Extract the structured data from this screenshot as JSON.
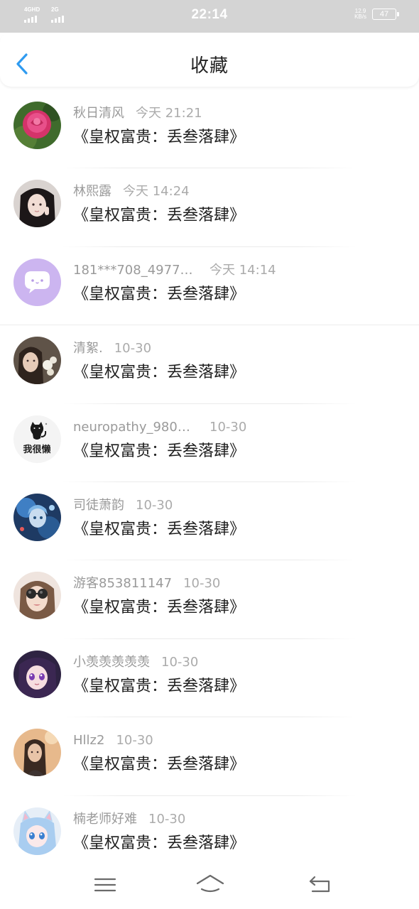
{
  "status_bar": {
    "signal_1_label": "4GHD",
    "signal_2_label": "2G",
    "time": "22:14",
    "net_speed_value": "12.9",
    "net_speed_unit": "KB/s",
    "battery": "47"
  },
  "header": {
    "title": "收藏",
    "back_icon": "chevron-left-icon",
    "back_color": "#2f9bf0"
  },
  "favorites": [
    {
      "user": "秋日清风",
      "time": "今天 21:21",
      "title": "《皇权富贵：丢叁落肆》",
      "avatar": "rose"
    },
    {
      "user": "林熙露",
      "time": "今天 14:24",
      "title": "《皇权富贵：丢叁落肆》",
      "avatar": "dark-hair-girl"
    },
    {
      "user": "181***708_4977…",
      "time": "今天 14:14",
      "title": "《皇权富贵：丢叁落肆》",
      "avatar": "chat-bubble"
    },
    {
      "user": "清絮.",
      "time": "10-30",
      "title": "《皇权富贵：丢叁落肆》",
      "avatar": "girl-with-flowers"
    },
    {
      "user": "neuropathy_980…",
      "time": "10-30",
      "title": "《皇权富贵：丢叁落肆》",
      "avatar": "cat-text",
      "avatar_text": "我很懒"
    },
    {
      "user": "司徒萧韵",
      "time": "10-30",
      "title": "《皇权富贵：丢叁落肆》",
      "avatar": "blue-anime"
    },
    {
      "user": "游客853811147",
      "time": "10-30",
      "title": "《皇权富贵：丢叁落肆》",
      "avatar": "sunglasses-girl"
    },
    {
      "user": "小羡羡羡羡羡",
      "time": "10-30",
      "title": "《皇权富贵：丢叁落肆》",
      "avatar": "purple-anime"
    },
    {
      "user": "Hllz2",
      "time": "10-30",
      "title": "《皇权富贵：丢叁落肆》",
      "avatar": "warm-portrait"
    },
    {
      "user": "楠老师好难",
      "time": "10-30",
      "title": "《皇权富贵：丢叁落肆》",
      "avatar": "cat-ear-anime"
    }
  ],
  "nav_bar": {
    "menu_icon": "menu-icon",
    "home_icon": "home-icon",
    "back_icon": "return-icon"
  }
}
